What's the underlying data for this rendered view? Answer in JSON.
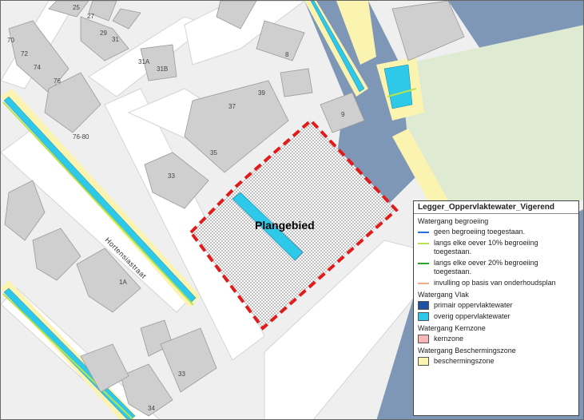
{
  "map": {
    "plan_label": "Plangebied",
    "street_name": "Hortensiastraat",
    "house_numbers": [
      "25",
      "27",
      "29",
      "31",
      "70",
      "72",
      "74",
      "76",
      "31A",
      "31B",
      "8",
      "37",
      "39",
      "35",
      "33",
      "9",
      "76-80",
      "1A",
      "33",
      "34"
    ]
  },
  "legend": {
    "title": "Legger_Oppervlaktewater_Vigerend",
    "groups": [
      {
        "title": "Watergang begroeiing",
        "items": [
          {
            "label": "geen begroeiing toegestaan.",
            "color": "#2b6fdc",
            "kind": "line"
          },
          {
            "label": "langs elke oever 10% begroeiing toegestaan.",
            "color": "#b8e34a",
            "kind": "line"
          },
          {
            "label": "langs elke oever 20% begroeiing toegestaan.",
            "color": "#2aa52a",
            "kind": "line"
          },
          {
            "label": "invulling op basis van onderhoudsplan",
            "color": "#f2a98a",
            "kind": "line"
          }
        ]
      },
      {
        "title": "Watergang Vlak",
        "items": [
          {
            "label": "primair oppervlaktewater",
            "color": "#1f4fa3",
            "kind": "box"
          },
          {
            "label": "overig oppervlaktewater",
            "color": "#2ec8e8",
            "kind": "box"
          }
        ]
      },
      {
        "title": "Watergang Kernzone",
        "items": [
          {
            "label": "kernzone",
            "color": "#f7b7b7",
            "kind": "box"
          }
        ]
      },
      {
        "title": "Watergang Beschermingszone",
        "items": [
          {
            "label": "beschermingszone",
            "color": "#fbf3b0",
            "kind": "box"
          }
        ]
      }
    ]
  },
  "colors": {
    "background": "#f0f0f0",
    "building": "#cfcfcf",
    "road": "#ffffff",
    "canal": "#7f97b6",
    "plan_border": "#e11b1b",
    "green": "#dfead3"
  }
}
